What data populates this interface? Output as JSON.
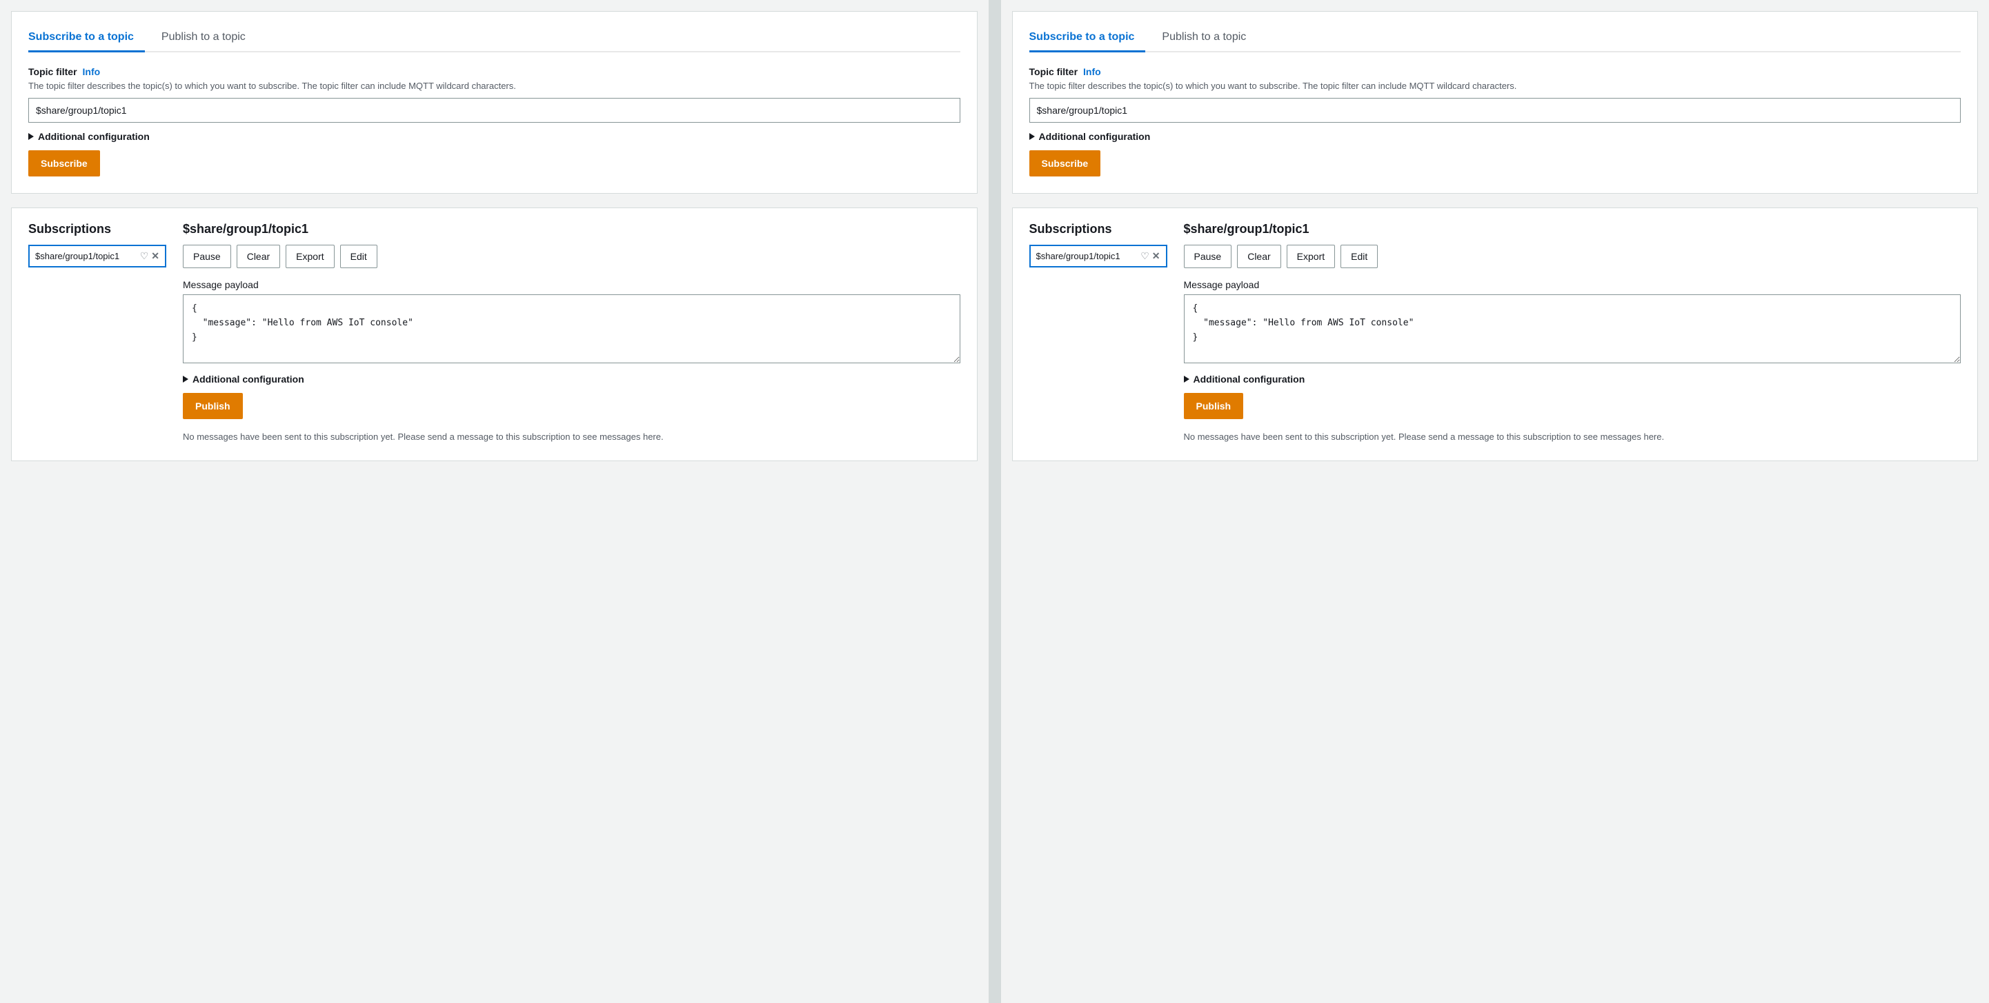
{
  "colors": {
    "accent": "#0972d3",
    "button_orange": "#e07b00",
    "border_active": "#0972d3"
  },
  "panels": [
    {
      "id": "left",
      "tabs": [
        {
          "label": "Subscribe to a topic",
          "active": true
        },
        {
          "label": "Publish to a topic",
          "active": false
        }
      ],
      "subscribe_form": {
        "topic_filter_label": "Topic filter",
        "info_label": "Info",
        "description": "The topic filter describes the topic(s) to which you want to subscribe. The topic filter can include MQTT wildcard characters.",
        "input_value": "$share/group1/topic1",
        "input_placeholder": "",
        "additional_config_label": "Additional configuration",
        "subscribe_btn": "Subscribe"
      },
      "subscriptions": {
        "title": "Subscriptions",
        "items": [
          {
            "topic": "$share/group1/topic1"
          }
        ]
      },
      "topic_panel": {
        "title": "$share/group1/topic1",
        "buttons": [
          {
            "label": "Pause"
          },
          {
            "label": "Clear"
          },
          {
            "label": "Export"
          },
          {
            "label": "Edit"
          }
        ],
        "payload_label": "Message payload",
        "payload_value": "{\n  \"message\": \"Hello from AWS IoT console\"\n}",
        "additional_config_label": "Additional configuration",
        "publish_btn": "Publish",
        "no_messages": "No messages have been sent to this subscription yet. Please send a message to this subscription to see messages here."
      }
    },
    {
      "id": "right",
      "tabs": [
        {
          "label": "Subscribe to a topic",
          "active": true
        },
        {
          "label": "Publish to a topic",
          "active": false
        }
      ],
      "subscribe_form": {
        "topic_filter_label": "Topic filter",
        "info_label": "Info",
        "description": "The topic filter describes the topic(s) to which you want to subscribe. The topic filter can include MQTT wildcard characters.",
        "input_value": "$share/group1/topic1",
        "input_placeholder": "",
        "additional_config_label": "Additional configuration",
        "subscribe_btn": "Subscribe"
      },
      "subscriptions": {
        "title": "Subscriptions",
        "items": [
          {
            "topic": "$share/group1/topic1"
          }
        ]
      },
      "topic_panel": {
        "title": "$share/group1/topic1",
        "buttons": [
          {
            "label": "Pause"
          },
          {
            "label": "Clear"
          },
          {
            "label": "Export"
          },
          {
            "label": "Edit"
          }
        ],
        "payload_label": "Message payload",
        "payload_value": "{\n  \"message\": \"Hello from AWS IoT console\"\n}",
        "additional_config_label": "Additional configuration",
        "publish_btn": "Publish",
        "no_messages": "No messages have been sent to this subscription yet. Please send a message to this subscription to see messages here."
      }
    }
  ]
}
